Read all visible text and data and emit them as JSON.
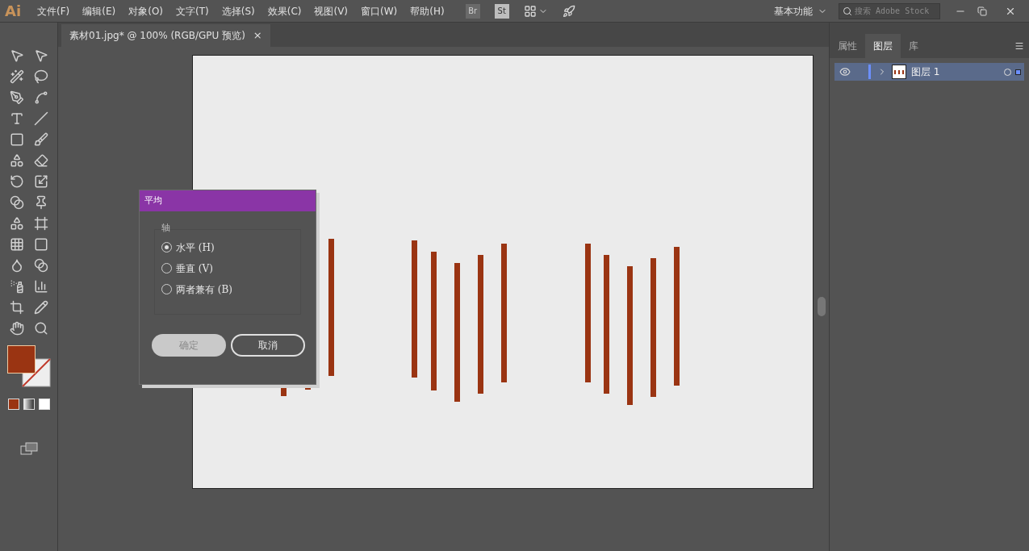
{
  "app_logo": "Ai",
  "menu": [
    "文件(F)",
    "编辑(E)",
    "对象(O)",
    "文字(T)",
    "选择(S)",
    "效果(C)",
    "视图(V)",
    "窗口(W)",
    "帮助(H)"
  ],
  "app_buttons": [
    "Br",
    "St"
  ],
  "workspace": "基本功能",
  "search": {
    "placeholder": "搜索 Adobe Stock"
  },
  "document_tab": {
    "title": "素材01.jpg* @ 100% (RGB/GPU 预览)",
    "close": "×"
  },
  "panel_tabs": [
    {
      "label": "属性",
      "selected": false
    },
    {
      "label": "图层",
      "selected": true
    },
    {
      "label": "库",
      "selected": false
    }
  ],
  "layers": [
    {
      "name": "图层 1",
      "visible": true,
      "selected": true
    }
  ],
  "dialog": {
    "title": "平均",
    "group_label": "轴",
    "options": [
      {
        "label": "水平 (H)",
        "selected": true
      },
      {
        "label": "垂直 (V)",
        "selected": false
      },
      {
        "label": "两者兼有 (B)",
        "selected": false
      }
    ],
    "buttons": [
      {
        "label": "确定",
        "kind": "primary"
      },
      {
        "label": "取消",
        "kind": "secondary"
      }
    ]
  }
}
